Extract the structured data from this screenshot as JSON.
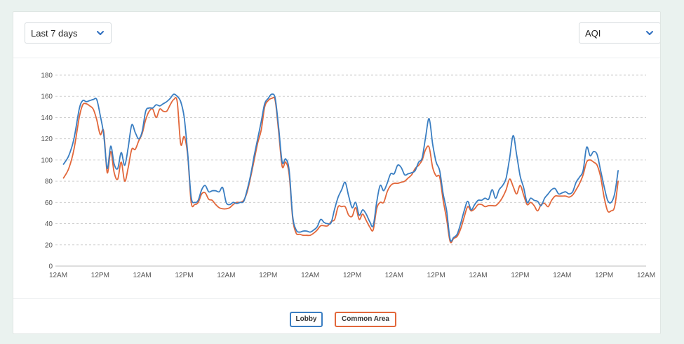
{
  "controls": {
    "range_select": {
      "value": "Last 7 days"
    },
    "metric_select": {
      "value": "AQI"
    }
  },
  "colors": {
    "lobby": "#3a7ec2",
    "common_area": "#e2673a",
    "grid": "#cfcfcf",
    "axis_text": "#555555",
    "chevron": "#2f6fc0"
  },
  "icons": {
    "dropdown": "chevron-down-icon"
  },
  "legend": [
    {
      "label": "Lobby",
      "color": "#3a7ec2"
    },
    {
      "label": "Common Area",
      "color": "#e2673a"
    }
  ],
  "chart_data": {
    "type": "line",
    "title": "",
    "xlabel": "",
    "ylabel": "",
    "ylim": [
      0,
      180
    ],
    "yticks": [
      0,
      20,
      40,
      60,
      80,
      100,
      120,
      140,
      160,
      180
    ],
    "xlim": [
      0,
      168
    ],
    "x_unit": "hours",
    "xticks": [
      0,
      12,
      24,
      36,
      48,
      60,
      72,
      84,
      96,
      108,
      120,
      132,
      144,
      156,
      168
    ],
    "xtick_labels": [
      "12AM",
      "12PM",
      "12AM",
      "12PM",
      "12AM",
      "12PM",
      "12AM",
      "12PM",
      "12AM",
      "12PM",
      "12AM",
      "12PM",
      "12AM",
      "12PM",
      "12AM"
    ],
    "grid": "horizontal dashed",
    "legend_position": "bottom-center",
    "series": [
      {
        "name": "Lobby",
        "color": "#3a7ec2",
        "points": [
          [
            1.5,
            96
          ],
          [
            3,
            104
          ],
          [
            4.5,
            120
          ],
          [
            6,
            148
          ],
          [
            7,
            156
          ],
          [
            8,
            155
          ],
          [
            9,
            156
          ],
          [
            10,
            157
          ],
          [
            11,
            157
          ],
          [
            12,
            142
          ],
          [
            13,
            124
          ],
          [
            14,
            92
          ],
          [
            15,
            113
          ],
          [
            16,
            96
          ],
          [
            17,
            92
          ],
          [
            18,
            107
          ],
          [
            19,
            95
          ],
          [
            20,
            112
          ],
          [
            21,
            133
          ],
          [
            22,
            126
          ],
          [
            23,
            120
          ],
          [
            24,
            127
          ],
          [
            25,
            146
          ],
          [
            26,
            149
          ],
          [
            27,
            149
          ],
          [
            28,
            152
          ],
          [
            29,
            151
          ],
          [
            30,
            153
          ],
          [
            31,
            155
          ],
          [
            32,
            158
          ],
          [
            33,
            162
          ],
          [
            34,
            160
          ],
          [
            35,
            155
          ],
          [
            36,
            140
          ],
          [
            37,
            106
          ],
          [
            38,
            65
          ],
          [
            39,
            60
          ],
          [
            40,
            62
          ],
          [
            41,
            72
          ],
          [
            42,
            76
          ],
          [
            43,
            70
          ],
          [
            44,
            71
          ],
          [
            45,
            71
          ],
          [
            46,
            70
          ],
          [
            47,
            74
          ],
          [
            48,
            60
          ],
          [
            49,
            58
          ],
          [
            50,
            60
          ],
          [
            51,
            59
          ],
          [
            52,
            60
          ],
          [
            53,
            61
          ],
          [
            54,
            72
          ],
          [
            55,
            86
          ],
          [
            56,
            104
          ],
          [
            57,
            120
          ],
          [
            58,
            136
          ],
          [
            59,
            153
          ],
          [
            60,
            158
          ],
          [
            61,
            162
          ],
          [
            62,
            158
          ],
          [
            63,
            130
          ],
          [
            64,
            98
          ],
          [
            65,
            101
          ],
          [
            66,
            90
          ],
          [
            67,
            47
          ],
          [
            68,
            34
          ],
          [
            69,
            32
          ],
          [
            70,
            33
          ],
          [
            71,
            33
          ],
          [
            72,
            32
          ],
          [
            73,
            34
          ],
          [
            74,
            37
          ],
          [
            75,
            44
          ],
          [
            76,
            41
          ],
          [
            77,
            40
          ],
          [
            78,
            41
          ],
          [
            79,
            54
          ],
          [
            80,
            65
          ],
          [
            81,
            72
          ],
          [
            82,
            79
          ],
          [
            83,
            66
          ],
          [
            84,
            55
          ],
          [
            85,
            60
          ],
          [
            86,
            48
          ],
          [
            87,
            53
          ],
          [
            88,
            49
          ],
          [
            89,
            42
          ],
          [
            90,
            38
          ],
          [
            91,
            60
          ],
          [
            92,
            76
          ],
          [
            93,
            71
          ],
          [
            94,
            78
          ],
          [
            95,
            87
          ],
          [
            96,
            87
          ],
          [
            97,
            95
          ],
          [
            98,
            93
          ],
          [
            99,
            86
          ],
          [
            100,
            87
          ],
          [
            101,
            88
          ],
          [
            102,
            90
          ],
          [
            103,
            98
          ],
          [
            104,
            102
          ],
          [
            105,
            122
          ],
          [
            106,
            139
          ],
          [
            107,
            115
          ],
          [
            108,
            98
          ],
          [
            109,
            90
          ],
          [
            110,
            68
          ],
          [
            111,
            52
          ],
          [
            112,
            25
          ],
          [
            113,
            27
          ],
          [
            114,
            30
          ],
          [
            115,
            40
          ],
          [
            116,
            52
          ],
          [
            117,
            61
          ],
          [
            118,
            53
          ],
          [
            119,
            58
          ],
          [
            120,
            62
          ],
          [
            121,
            62
          ],
          [
            122,
            64
          ],
          [
            123,
            63
          ],
          [
            124,
            72
          ],
          [
            125,
            64
          ],
          [
            126,
            72
          ],
          [
            127,
            76
          ],
          [
            128,
            83
          ],
          [
            129,
            102
          ],
          [
            130,
            123
          ],
          [
            131,
            105
          ],
          [
            132,
            85
          ],
          [
            133,
            74
          ],
          [
            134,
            60
          ],
          [
            135,
            64
          ],
          [
            136,
            62
          ],
          [
            137,
            61
          ],
          [
            138,
            57
          ],
          [
            139,
            64
          ],
          [
            140,
            68
          ],
          [
            141,
            72
          ],
          [
            142,
            73
          ],
          [
            143,
            68
          ],
          [
            144,
            69
          ],
          [
            145,
            70
          ],
          [
            146,
            68
          ],
          [
            147,
            70
          ],
          [
            148,
            79
          ],
          [
            149,
            84
          ],
          [
            150,
            90
          ],
          [
            151,
            112
          ],
          [
            152,
            104
          ],
          [
            153,
            108
          ],
          [
            154,
            105
          ],
          [
            155,
            90
          ],
          [
            156,
            75
          ],
          [
            157,
            62
          ],
          [
            158,
            60
          ],
          [
            159,
            68
          ],
          [
            160,
            90
          ]
        ]
      },
      {
        "name": "Common Area",
        "color": "#e2673a",
        "points": [
          [
            1.5,
            83
          ],
          [
            3,
            92
          ],
          [
            4.5,
            110
          ],
          [
            6,
            140
          ],
          [
            7,
            152
          ],
          [
            8,
            153
          ],
          [
            9,
            151
          ],
          [
            10,
            148
          ],
          [
            11,
            138
          ],
          [
            12,
            124
          ],
          [
            13,
            127
          ],
          [
            14,
            88
          ],
          [
            15,
            108
          ],
          [
            16,
            88
          ],
          [
            17,
            82
          ],
          [
            18,
            98
          ],
          [
            19,
            80
          ],
          [
            20,
            93
          ],
          [
            21,
            110
          ],
          [
            22,
            110
          ],
          [
            23,
            118
          ],
          [
            24,
            125
          ],
          [
            25,
            138
          ],
          [
            26,
            146
          ],
          [
            27,
            148
          ],
          [
            28,
            140
          ],
          [
            29,
            148
          ],
          [
            30,
            146
          ],
          [
            31,
            146
          ],
          [
            32,
            152
          ],
          [
            33,
            157
          ],
          [
            34,
            155
          ],
          [
            35,
            115
          ],
          [
            36,
            122
          ],
          [
            37,
            104
          ],
          [
            38,
            60
          ],
          [
            39,
            58
          ],
          [
            40,
            60
          ],
          [
            41,
            68
          ],
          [
            42,
            69
          ],
          [
            43,
            63
          ],
          [
            44,
            62
          ],
          [
            45,
            58
          ],
          [
            46,
            55
          ],
          [
            47,
            54
          ],
          [
            48,
            54
          ],
          [
            49,
            55
          ],
          [
            50,
            58
          ],
          [
            51,
            60
          ],
          [
            52,
            60
          ],
          [
            53,
            62
          ],
          [
            54,
            70
          ],
          [
            55,
            84
          ],
          [
            56,
            100
          ],
          [
            57,
            116
          ],
          [
            58,
            128
          ],
          [
            59,
            150
          ],
          [
            60,
            156
          ],
          [
            61,
            158
          ],
          [
            62,
            156
          ],
          [
            63,
            126
          ],
          [
            64,
            94
          ],
          [
            65,
            98
          ],
          [
            66,
            86
          ],
          [
            67,
            45
          ],
          [
            68,
            31
          ],
          [
            69,
            30
          ],
          [
            70,
            29
          ],
          [
            71,
            29
          ],
          [
            72,
            29
          ],
          [
            73,
            31
          ],
          [
            74,
            34
          ],
          [
            75,
            38
          ],
          [
            76,
            38
          ],
          [
            77,
            38
          ],
          [
            78,
            42
          ],
          [
            79,
            44
          ],
          [
            80,
            56
          ],
          [
            81,
            56
          ],
          [
            82,
            56
          ],
          [
            83,
            48
          ],
          [
            84,
            47
          ],
          [
            85,
            55
          ],
          [
            86,
            44
          ],
          [
            87,
            49
          ],
          [
            88,
            43
          ],
          [
            89,
            37
          ],
          [
            90,
            34
          ],
          [
            91,
            54
          ],
          [
            92,
            60
          ],
          [
            93,
            60
          ],
          [
            94,
            70
          ],
          [
            95,
            76
          ],
          [
            96,
            78
          ],
          [
            97,
            78
          ],
          [
            98,
            79
          ],
          [
            99,
            80
          ],
          [
            100,
            83
          ],
          [
            101,
            86
          ],
          [
            102,
            92
          ],
          [
            103,
            95
          ],
          [
            104,
            100
          ],
          [
            105,
            110
          ],
          [
            106,
            112
          ],
          [
            107,
            93
          ],
          [
            108,
            85
          ],
          [
            109,
            84
          ],
          [
            110,
            62
          ],
          [
            111,
            44
          ],
          [
            112,
            23
          ],
          [
            113,
            26
          ],
          [
            114,
            28
          ],
          [
            115,
            35
          ],
          [
            116,
            46
          ],
          [
            117,
            56
          ],
          [
            118,
            52
          ],
          [
            119,
            54
          ],
          [
            120,
            58
          ],
          [
            121,
            58
          ],
          [
            122,
            56
          ],
          [
            123,
            57
          ],
          [
            124,
            57
          ],
          [
            125,
            57
          ],
          [
            126,
            60
          ],
          [
            127,
            65
          ],
          [
            128,
            72
          ],
          [
            129,
            82
          ],
          [
            130,
            75
          ],
          [
            131,
            68
          ],
          [
            132,
            76
          ],
          [
            133,
            67
          ],
          [
            134,
            58
          ],
          [
            135,
            60
          ],
          [
            136,
            57
          ],
          [
            137,
            52
          ],
          [
            138,
            58
          ],
          [
            139,
            59
          ],
          [
            140,
            56
          ],
          [
            141,
            62
          ],
          [
            142,
            66
          ],
          [
            143,
            66
          ],
          [
            144,
            66
          ],
          [
            145,
            66
          ],
          [
            146,
            65
          ],
          [
            147,
            67
          ],
          [
            148,
            72
          ],
          [
            149,
            78
          ],
          [
            150,
            86
          ],
          [
            151,
            98
          ],
          [
            152,
            100
          ],
          [
            153,
            98
          ],
          [
            154,
            95
          ],
          [
            155,
            84
          ],
          [
            156,
            65
          ],
          [
            157,
            52
          ],
          [
            158,
            52
          ],
          [
            159,
            56
          ],
          [
            160,
            80
          ]
        ]
      }
    ]
  }
}
